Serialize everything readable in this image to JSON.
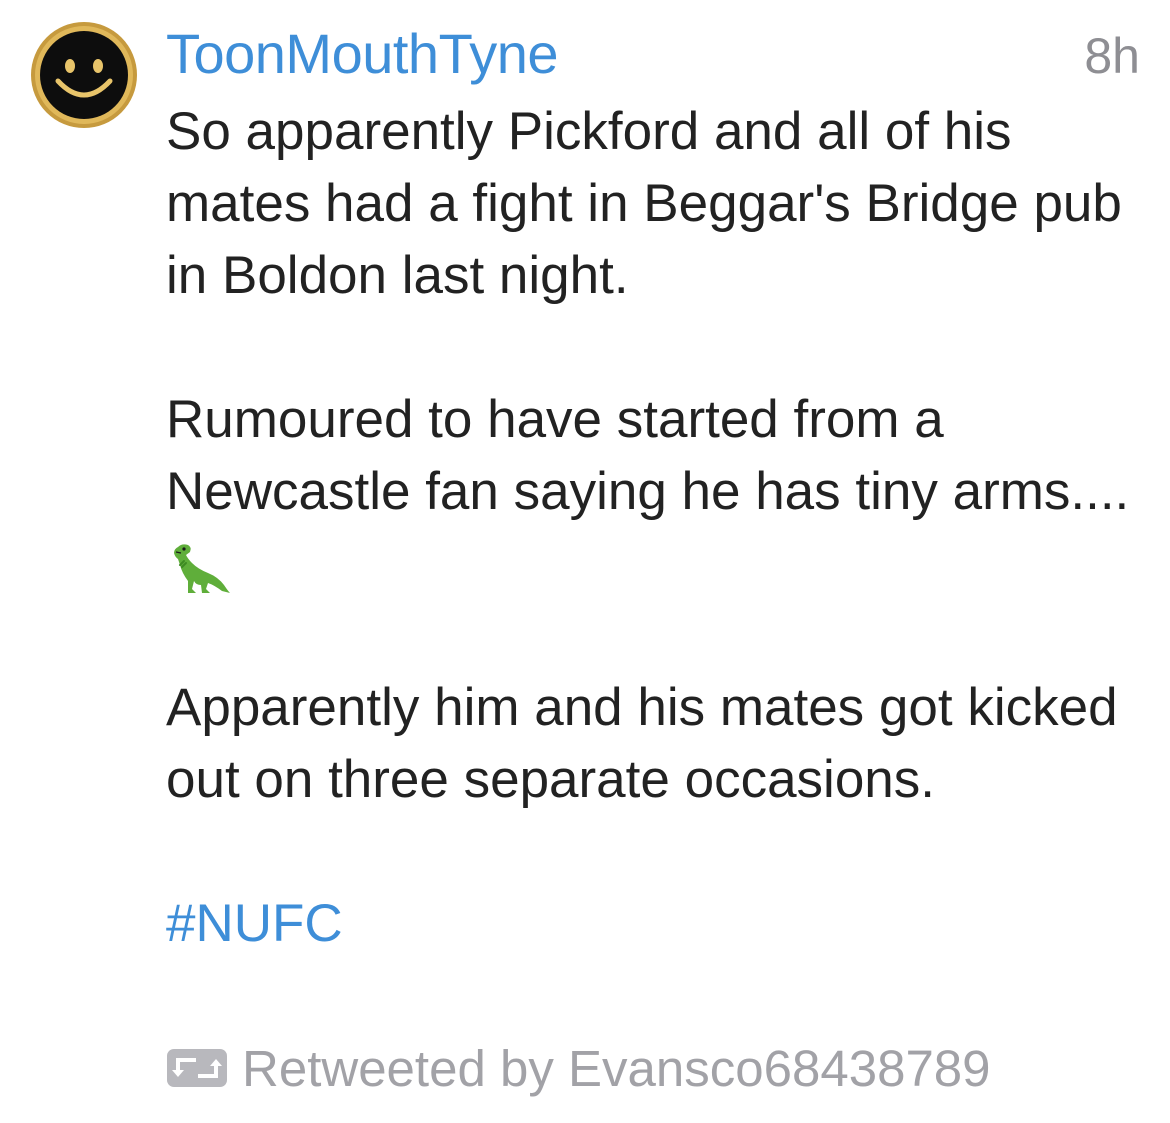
{
  "tweet": {
    "author": "ToonMouthTyne",
    "time": "8h",
    "avatar_icon": "smiley-face-icon",
    "paragraphs": [
      "So apparently Pickford and all of his mates had a fight in Beggar's Bridge pub in Boldon last night.",
      "Rumoured to have started from a Newcastle fan saying he has tiny arms....",
      "Apparently him and his mates got kicked out on three separate occasions."
    ],
    "emoji": "t-rex-icon",
    "hashtag": "#NUFC",
    "retweet": {
      "icon": "retweet-icon",
      "label": "Retweeted by Evansco68438789"
    }
  },
  "colors": {
    "link": "#3e8ed8",
    "text": "#222222",
    "muted": "#8e8e93",
    "avatar_ring": "#c9a44a"
  }
}
